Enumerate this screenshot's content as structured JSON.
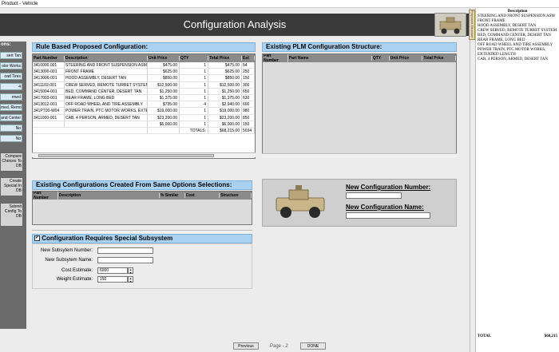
{
  "window": {
    "title": "Product - Vehicle"
  },
  "header": {
    "title": "Configuration Analysis",
    "vehicle_icon": "armored-vehicle-icon"
  },
  "options_panel": {
    "title": "ons:",
    "items": [
      "sert Tan",
      "olor Works",
      "oad Tires",
      "4",
      "rmed",
      "med, Remot",
      "and Center",
      "No",
      "No"
    ]
  },
  "side_buttons": {
    "compare": "Compare Choices To DB",
    "create": "Create Special In DB",
    "submit": "Submit Config To DB"
  },
  "rule_based": {
    "title": "Rule Based Proposed Configuration:",
    "columns": [
      "Part Number",
      "Description",
      "Unit Price",
      "QTY",
      "Total Price",
      "Est"
    ],
    "rows": [
      [
        "3410000.001",
        "STEERING AND FRONT SUSPENSION ASM",
        "$475.00",
        "1",
        "$475.00",
        "54"
      ],
      [
        "3413000-001",
        "FRONT FRAME",
        "$625.00",
        "1",
        "$625.00",
        "250"
      ],
      [
        "3413006-001",
        "HOOD ASSEMBLY, DESERT TAN",
        "$850.00",
        "1",
        "$850.00",
        "150"
      ],
      [
        "3411102-001",
        "CREW SERVED, REMOTE TURRET SYSTEM",
        "$12,500.00",
        "1",
        "$12,500.00",
        "300"
      ],
      [
        "3415004-001",
        "BED, COMMAND CENTER, DESERT TAN",
        "$1,250.00",
        "1",
        "$1,250.00",
        "650"
      ],
      [
        "3417003-001",
        "REAR FRAME, LONG BED",
        "$1,375.00",
        "1",
        "$1,375.00",
        "630"
      ],
      [
        "3413012-001",
        "OFF ROAD WHEEL AND TIRE ASSEMBLY",
        "$735.00",
        "4",
        "$2,940.00",
        "600"
      ],
      [
        "341PT00-W04",
        "POWER TRAIN, PTC MOTOR WORKS, EXTEN...",
        "$19,000.00",
        "1",
        "$19,000.00",
        "980"
      ],
      [
        "3411000-001",
        "CAB, 4 PERSON, ARMED, DESERT TAN",
        "$23,200.00",
        "1",
        "$23,200.00",
        "850"
      ],
      [
        "",
        "",
        "$6,000.00",
        "1",
        "$6,000.00",
        "150"
      ]
    ],
    "totals_label": "TOTALS:",
    "totals_value": "$68,215.00",
    "totals_est": "5034"
  },
  "plm": {
    "title": "Existing PLM Configuration Structure:",
    "columns": [
      "Part Number",
      "Part Name",
      "QTY",
      "Unit Price",
      "Total Price"
    ]
  },
  "existing_configs": {
    "title": "Existing Configurations Created From Same Options Selections:",
    "columns": [
      "Part Number",
      "Description",
      "% Similar",
      "Cost",
      "Structure"
    ]
  },
  "new_config": {
    "number_label": "New Configuration Number:",
    "name_label": "New Configuration Name:",
    "number_value": "",
    "name_value": ""
  },
  "subsystem": {
    "checkbox_label": "Configuration Requires Special Subsystem",
    "checked": true,
    "number_label": "New Subsytem Number:",
    "name_label": "New Subsytem Name:",
    "cost_label": "Cost Estimate:",
    "cost_value": "6000",
    "weight_label": "Weight Estimate:",
    "weight_value": "150"
  },
  "footer": {
    "previous": "Previous",
    "page": "Page - 2",
    "done": "DONE"
  },
  "description_panel": {
    "header": "Description",
    "items": [
      "STEERING AND FRONT SUSPENSION ASM",
      "FRONT FRAME",
      "HOOD ASSEMBLY, DESERT TAN",
      "CREW SERVED, REMOTE TURRET SYSTEM",
      "BED, COMMAND CENTER, DESERT TAN",
      "REAR FRAME, LONG BED",
      "OFF ROAD WHEEL AND TIRE ASSEMBLY",
      "POWER TRAIN, PTC MOTOR WORKS, EXTENDED LENGTH",
      "CAB, 4 PERSON, ARMED, DESERT TAN"
    ],
    "total_label": "TOTAL",
    "total_value": "$68,215"
  },
  "side_tabs": {
    "label": "Proposed Structure"
  }
}
